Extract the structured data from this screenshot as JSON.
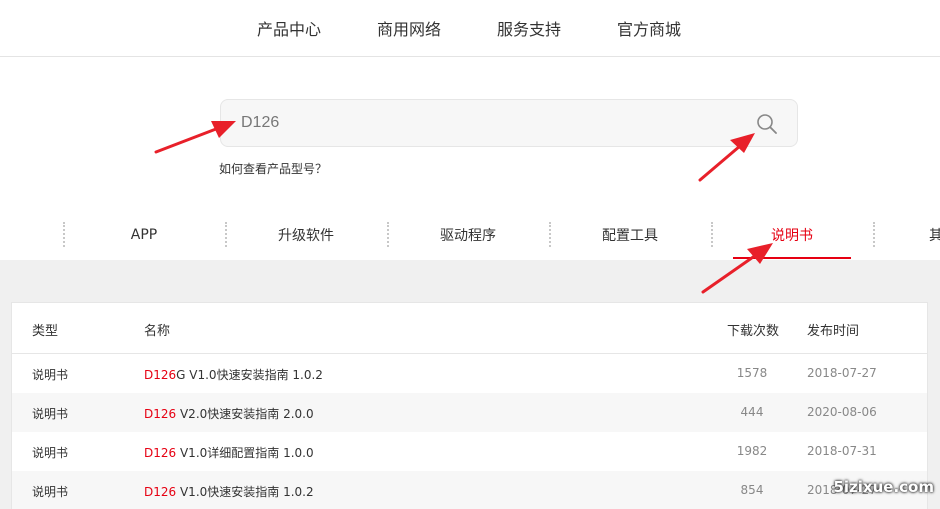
{
  "topnav": {
    "items": [
      {
        "label": "产品中心"
      },
      {
        "label": "商用网络"
      },
      {
        "label": "服务支持"
      },
      {
        "label": "官方商城"
      }
    ]
  },
  "search": {
    "value": "D126",
    "help_link": "如何查看产品型号？",
    "icon": "search-icon"
  },
  "tabs": {
    "items": [
      {
        "label": ""
      },
      {
        "label": "APP"
      },
      {
        "label": "升级软件"
      },
      {
        "label": "驱动程序"
      },
      {
        "label": "配置工具"
      },
      {
        "label": "说明书"
      },
      {
        "label": "其"
      }
    ],
    "active_index": 5,
    "active_color": "#e60012"
  },
  "table": {
    "headers": {
      "type": "类型",
      "name": "名称",
      "downloads": "下载次数",
      "date": "发布时间"
    },
    "rows": [
      {
        "type": "说明书",
        "model": "D126",
        "name_rest": "G V1.0快速安装指南 1.0.2",
        "downloads": "1578",
        "date": "2018-07-27"
      },
      {
        "type": "说明书",
        "model": "D126",
        "name_rest": " V2.0快速安装指南 2.0.0",
        "downloads": "444",
        "date": "2020-08-06"
      },
      {
        "type": "说明书",
        "model": "D126",
        "name_rest": " V1.0详细配置指南 1.0.0",
        "downloads": "1982",
        "date": "2018-07-31"
      },
      {
        "type": "说明书",
        "model": "D126",
        "name_rest": " V1.0快速安装指南 1.0.2",
        "downloads": "854",
        "date": "2018-07-27"
      }
    ]
  },
  "watermark": "5izixue.com",
  "colors": {
    "accent": "#e60012",
    "annotation": "#e8202a"
  }
}
